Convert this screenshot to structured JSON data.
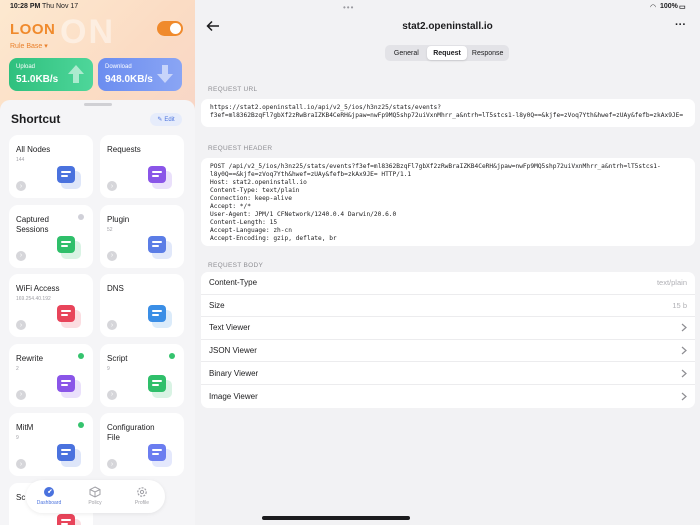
{
  "status": {
    "time": "10:28 PM",
    "date": "Thu Nov 17",
    "battery": "100%"
  },
  "app": {
    "title": "LOON",
    "rule_base": "Rule Base",
    "upload_label": "Upload",
    "upload_value": "51.0KB/s",
    "download_label": "Download",
    "download_value": "948.0KB/s",
    "accent": "#f08a2c"
  },
  "shortcut": {
    "title": "Shortcut",
    "edit_label": "Edit",
    "tiles": [
      {
        "title": "All Nodes",
        "sub": "144",
        "icon": "server-toggle-icon"
      },
      {
        "title": "Requests",
        "sub": "",
        "icon": "document-list-icon"
      },
      {
        "title": "Captured Sessions",
        "sub": "",
        "icon": "capture-package-icon",
        "dot": "#d0d0d8"
      },
      {
        "title": "Plugin",
        "sub": "52",
        "icon": "puzzle-icon"
      },
      {
        "title": "WiFi Access",
        "sub": "169.254.40.192",
        "icon": "fingerprint-icon"
      },
      {
        "title": "DNS",
        "sub": "",
        "icon": "location-pin-icon"
      },
      {
        "title": "Rewrite",
        "sub": "2",
        "icon": "rewrite-icon",
        "dot": "#35c36e"
      },
      {
        "title": "Script",
        "sub": "9",
        "icon": "code-window-icon",
        "dot": "#35c36e"
      },
      {
        "title": "MitM",
        "sub": "9",
        "icon": "lock-icon",
        "dot": "#35c36e"
      },
      {
        "title": "Configuration File",
        "sub": "",
        "icon": "config-file-icon"
      },
      {
        "title": "Sc",
        "sub": "",
        "icon": "generic-icon"
      }
    ]
  },
  "tabs": {
    "dashboard": "Dashboard",
    "policy": "Policy",
    "profile": "Profile"
  },
  "detail": {
    "title": "stat2.openinstall.io",
    "segments": [
      "General",
      "Request",
      "Response"
    ],
    "active_segment": "Request",
    "request_url_label": "REQUEST URL",
    "request_url": "https://stat2.openinstall.io/api/v2_5/ios/h3nz25/stats/events?\nf3ef=ml8362BzqFl7gbXf2zRwBraIZKB4CeRH&jpaw=nwFp9MQ5shp72uiVxnMhrr_a&ntrh=lT5stcs1-l8y0Q==&kjfe=zVoq7Yth&hwef=zUAy&fefb=zkAx9JE=",
    "request_header_label": "REQUEST HEADER",
    "request_header": "POST /api/v2_5/ios/h3nz25/stats/events?f3ef=ml8362BzqFl7gbXf2zRwBraIZKB4CeRH&jpaw=nwFp9MQ5shp72uiVxnMhrr_a&ntrh=lT5stcs1-\nl8y0Q==&kjfe=zVoq7Yth&hwef=zUAy&fefb=zkAx9JE= HTTP/1.1\nHost: stat2.openinstall.io\nContent-Type: text/plain\nConnection: keep-alive\nAccept: */*\nUser-Agent: JPM/1 CFNetwork/1240.0.4 Darwin/20.6.0\nContent-Length: 15\nAccept-Language: zh-cn\nAccept-Encoding: gzip, deflate, br",
    "request_body_label": "REQUEST BODY",
    "body_rows": [
      {
        "label": "Content-Type",
        "value": "text/plain"
      },
      {
        "label": "Size",
        "value": "15 b"
      },
      {
        "label": "Text Viewer",
        "value": ""
      },
      {
        "label": "JSON Viewer",
        "value": ""
      },
      {
        "label": "Binary Viewer",
        "value": ""
      },
      {
        "label": "Image Viewer",
        "value": ""
      }
    ]
  }
}
